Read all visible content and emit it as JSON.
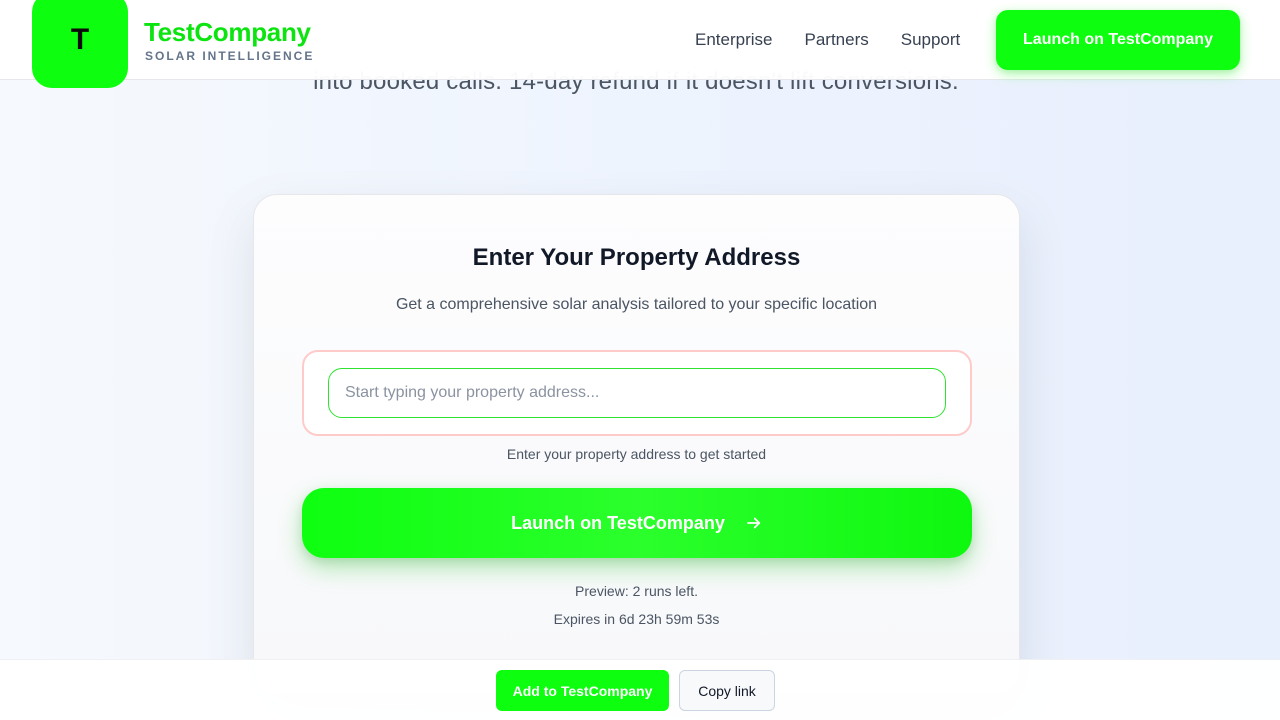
{
  "hero": {
    "subtitle_fragment": "into booked calls. 14-day refund if it doesn't lift conversions."
  },
  "header": {
    "logo_letter": "T",
    "brand_name": "TestCompany",
    "brand_tagline": "SOLAR INTELLIGENCE",
    "nav": [
      {
        "label": "Enterprise"
      },
      {
        "label": "Partners"
      },
      {
        "label": "Support"
      }
    ],
    "cta_label": "Launch on TestCompany"
  },
  "card": {
    "title": "Enter Your Property Address",
    "subtitle": "Get a comprehensive solar analysis tailored to your specific location",
    "address_input": {
      "value": "",
      "placeholder": "Start typing your property address..."
    },
    "helper_text": "Enter your property address to get started",
    "launch_label": "Launch on TestCompany",
    "preview_text": "Preview: 2 runs left.",
    "expires_text": "Expires in 6d 23h 59m 53s"
  },
  "bottom_bar": {
    "add_label": "Add to TestCompany",
    "copy_label": "Copy link"
  },
  "colors": {
    "brand_green": "#0dff0f",
    "brand_text_green": "#0be40f",
    "input_border": "#2ee32f",
    "error_outline": "#fecaca"
  },
  "icons": {
    "launch_arrow": "arrow-right-icon"
  }
}
